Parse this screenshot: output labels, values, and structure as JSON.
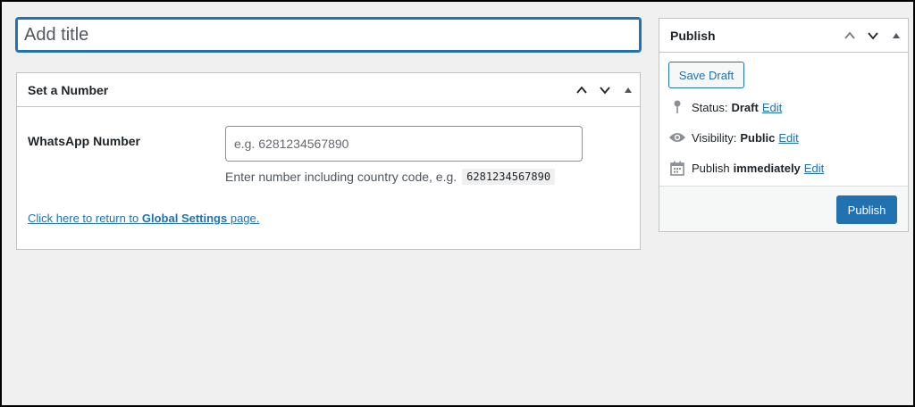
{
  "title_field": {
    "placeholder": "Add title",
    "value": ""
  },
  "number_box": {
    "title": "Set a Number",
    "field_label": "WhatsApp Number",
    "input_placeholder": "e.g. 6281234567890",
    "hint_text": "Enter number including country code, e.g.",
    "hint_code": "6281234567890",
    "link_prefix": "Click here to return to ",
    "link_bold": "Global Settings",
    "link_suffix": " page."
  },
  "publish_box": {
    "title": "Publish",
    "save_draft_label": "Save Draft",
    "status_label": "Status:",
    "status_value": "Draft",
    "visibility_label": "Visibility:",
    "visibility_value": "Public",
    "publish_label": "Publish",
    "publish_value": "immediately",
    "edit_label": "Edit",
    "publish_button_label": "Publish"
  },
  "icons": {
    "move_up": "chevron-up-icon",
    "move_down": "chevron-down-icon",
    "toggle": "triangle-up-icon",
    "status": "pin-icon",
    "visibility": "eye-icon",
    "schedule": "calendar-icon"
  },
  "colors": {
    "accent": "#2271b1",
    "background": "#f0f0f1",
    "border": "#c3c4c7"
  }
}
